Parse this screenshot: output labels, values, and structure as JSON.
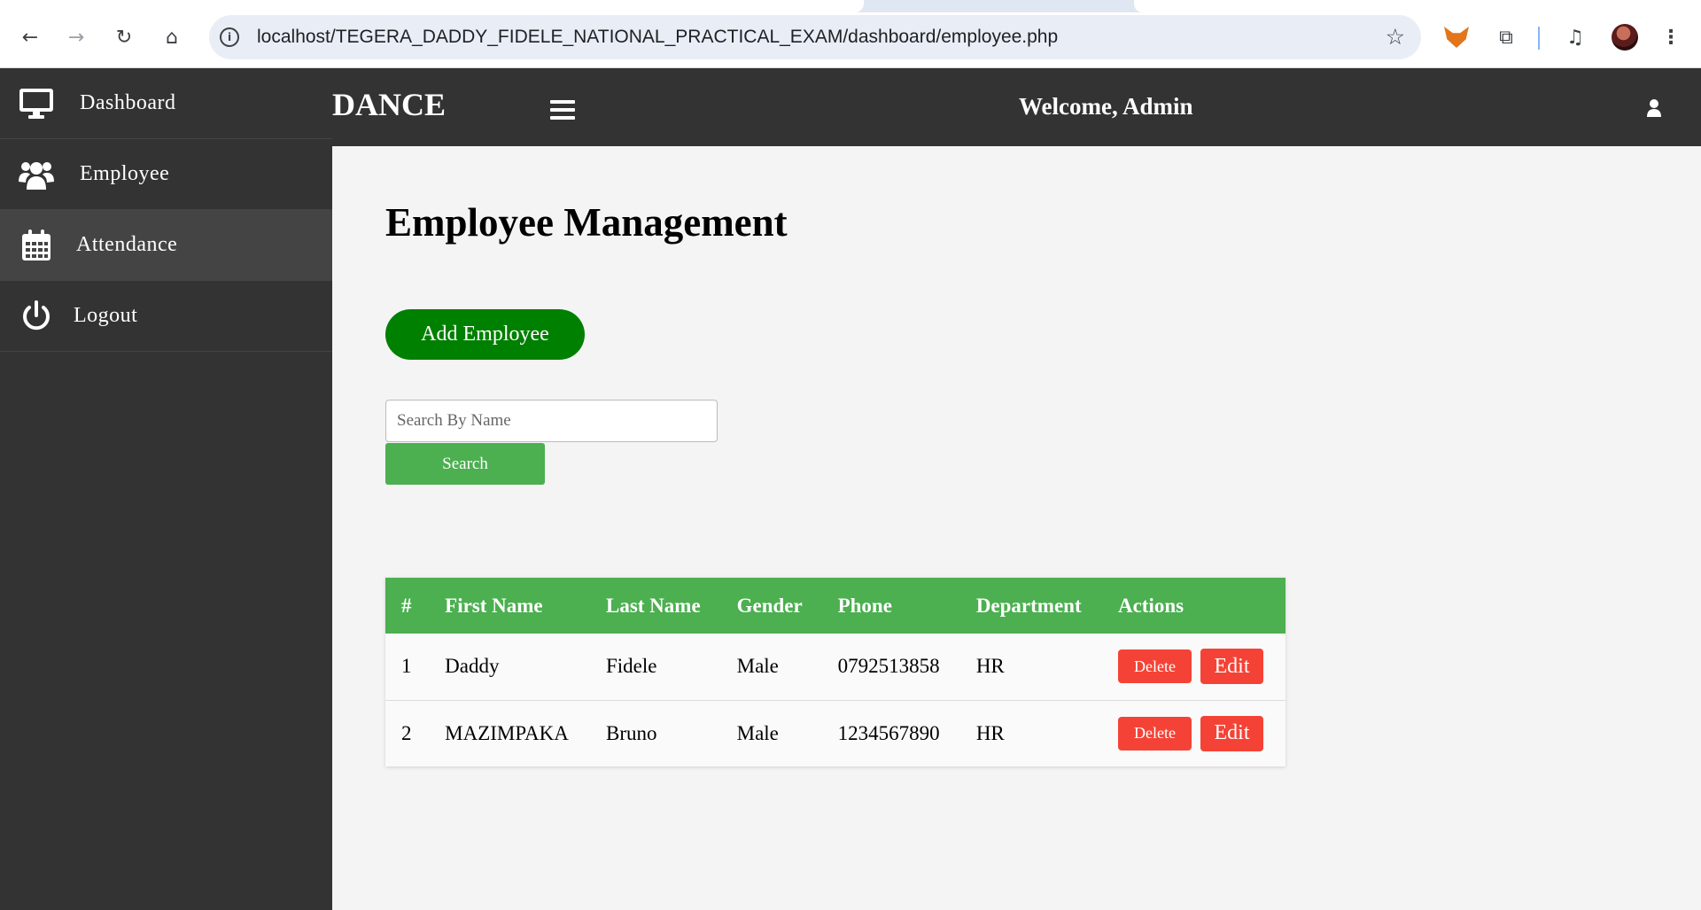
{
  "browser": {
    "url": "localhost/TEGERA_DADDY_FIDELE_NATIONAL_PRACTICAL_EXAM/dashboard/employee.php",
    "back_icon": "←",
    "forward_icon": "→",
    "reload_icon": "↻",
    "home_icon": "⌂",
    "star_icon": "☆",
    "puzzle_icon": "⧉",
    "media_icon": "♫",
    "menu_icon": "⋮"
  },
  "topbar": {
    "brand": "DANCE",
    "welcome": "Welcome, Admin"
  },
  "sidebar": {
    "items": [
      {
        "label": "Dashboard",
        "icon": "monitor-icon"
      },
      {
        "label": "Employee",
        "icon": "users-icon"
      },
      {
        "label": "Attendance",
        "icon": "calendar-icon"
      },
      {
        "label": "Logout",
        "icon": "power-icon"
      }
    ]
  },
  "main": {
    "title": "Employee Management",
    "add_button": "Add Employee",
    "search_placeholder": "Search By Name",
    "search_button": "Search",
    "table": {
      "headers": [
        "#",
        "First Name",
        "Last Name",
        "Gender",
        "Phone",
        "Department",
        "Actions"
      ],
      "rows": [
        {
          "num": "1",
          "first": "Daddy",
          "last": "Fidele",
          "gender": "Male",
          "phone": "0792513858",
          "dept": "HR"
        },
        {
          "num": "2",
          "first": "MAZIMPAKA",
          "last": "Bruno",
          "gender": "Male",
          "phone": "1234567890",
          "dept": "HR"
        }
      ],
      "delete_label": "Delete",
      "edit_label": "Edit"
    }
  },
  "colors": {
    "sidebar_bg": "#333333",
    "active_bg": "#444444",
    "header_green": "#4caf50",
    "add_green": "#008000",
    "danger": "#f44336"
  }
}
